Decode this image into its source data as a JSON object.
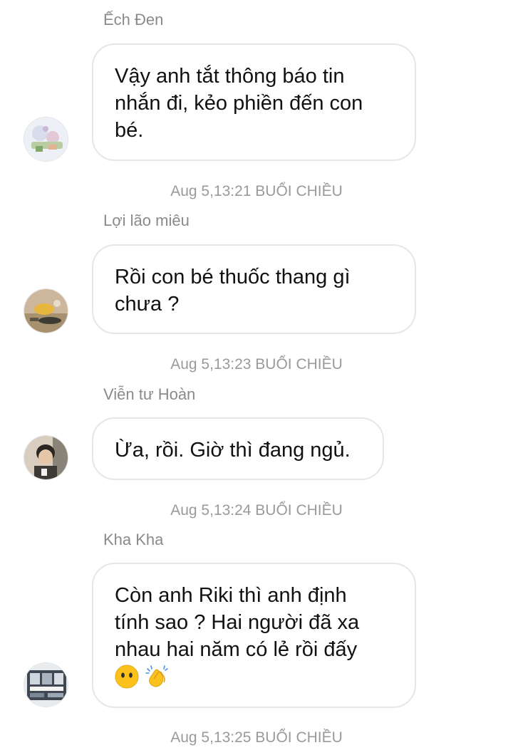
{
  "messages": [
    {
      "sender": "Ếch Đen",
      "text": "Vậy anh tắt thông báo tin\nnhắn đi, kẻo phiền đến con\nbé.",
      "avatar_icon": "avatar-ech-den",
      "timestamp": "Aug 5,13:21 BUỔI CHIỀU"
    },
    {
      "sender": "Lợi lão miêu",
      "text": "Rồi con bé thuốc thang gì\nchưa ?",
      "avatar_icon": "avatar-loi-lao-mieu",
      "timestamp": "Aug 5,13:23 BUỔI CHIỀU"
    },
    {
      "sender": "Viễn tư Hoàn",
      "text": "Ừa, rồi. Giờ thì đang ngủ.",
      "avatar_icon": "avatar-vien-tu-hoan",
      "timestamp": "Aug 5,13:24 BUỔI CHIỀU"
    },
    {
      "sender": "Kha Kha",
      "text": "Còn anh Riki thì anh định\ntính sao ? Hai người đã xa\nnhau hai năm có lẻ rồi đấy",
      "emojis": [
        "no-mouth-face-icon",
        "clapping-hands-icon"
      ],
      "avatar_icon": "avatar-kha-kha",
      "timestamp": "Aug 5,13:25 BUỔI CHIỀU"
    }
  ],
  "colors": {
    "sender_name": "#8a8a8a",
    "timestamp": "#9a9a9a",
    "bubble_border": "#e6e6e6",
    "message_text": "#111111",
    "background": "#ffffff"
  }
}
